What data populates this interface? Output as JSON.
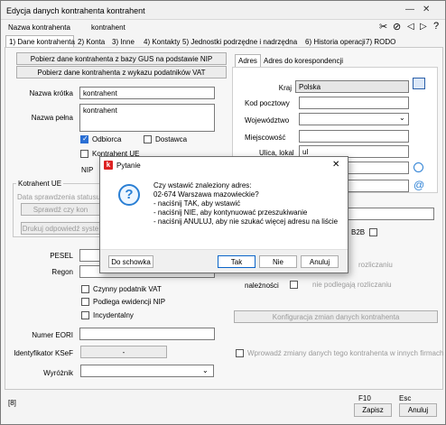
{
  "window": {
    "title": "Edycja danych kontrahenta kontrahent"
  },
  "header": {
    "name_label": "Nazwa kontrahenta",
    "name_value": "kontrahent"
  },
  "tabs": [
    "1) Dane kontrahenta",
    "2) Konta",
    "3) Inne",
    "4) Kontakty",
    "5) Jednostki podrzędne i nadrzędna",
    "6) Historia operacji",
    "7) RODO"
  ],
  "left": {
    "btn_gus": "Pobierz dane kontrahenta z bazy GUS na podstawie NIP",
    "btn_vat": "Pobierz dane kontrahenta z wykazu podatników VAT",
    "short_name_label": "Nazwa krótka",
    "short_name_value": "kontrahent",
    "full_name_label": "Nazwa pełna",
    "full_name_value": "kontrahent",
    "chk_odbiorca": "Odbiorca",
    "chk_dostawca": "Dostawca",
    "chk_kontrahent_ue": "Kontrahent UE",
    "nip_label": "NIP",
    "ue_group_label": "Kotrahent UE",
    "ue_date_label": "Data sprawdzenia statusu",
    "btn_sprawdz": "Sprawdź czy kon",
    "btn_drukuj": "Drukuj odpowiedź syste",
    "pesel_label": "PESEL",
    "regon_label": "Regon",
    "chk_vat": "Czynny podatnik VAT",
    "chk_ewid": "Podlega ewidencji NIP",
    "chk_incyd": "Incydentalny",
    "eori_label": "Numer EORI",
    "ksef_label": "Identyfikator KSeF",
    "ksef_value": "-",
    "wyroznik_label": "Wyróżnik"
  },
  "right": {
    "tab_adres": "Adres",
    "tab_koresp": "Adres do korespondencji",
    "kraj_label": "Kraj",
    "kraj_value": "Polska",
    "kod_label": "Kod pocztowy",
    "woj_label": "Województwo",
    "miej_label": "Miejscowość",
    "ulica_label": "Ulica, lokal",
    "ulica_value": "ul",
    "b2b_label": "B2B",
    "rozlicz_label": "rozliczaniu",
    "naleznosci_label": "należności",
    "niepodlega_label": "nie podlegają rozliczaniu",
    "btn_konfig": "Konfiguracja zmian danych kontrahenta",
    "chk_wprowadz": "Wprowadź zmiany danych tego kontrahenta w innych firmach"
  },
  "dialog": {
    "title": "Pytanie",
    "message": "Czy wstawić znaleziony adres:\n02-674 Warszawa mazowieckie?\n- naciśnij TAK, aby wstawić\n- naciśnij NIE, aby kontynuować przeszukiwanie\n- naciśnij ANULUJ, aby nie szukać więcej adresu na liście",
    "btn_clipboard": "Do schowka",
    "btn_yes": "Tak",
    "btn_no": "Nie",
    "btn_cancel": "Anuluj"
  },
  "footer": {
    "indicator": "[8]",
    "f10": "F10",
    "esc": "Esc",
    "save": "Zapisz",
    "cancel": "Anuluj"
  }
}
